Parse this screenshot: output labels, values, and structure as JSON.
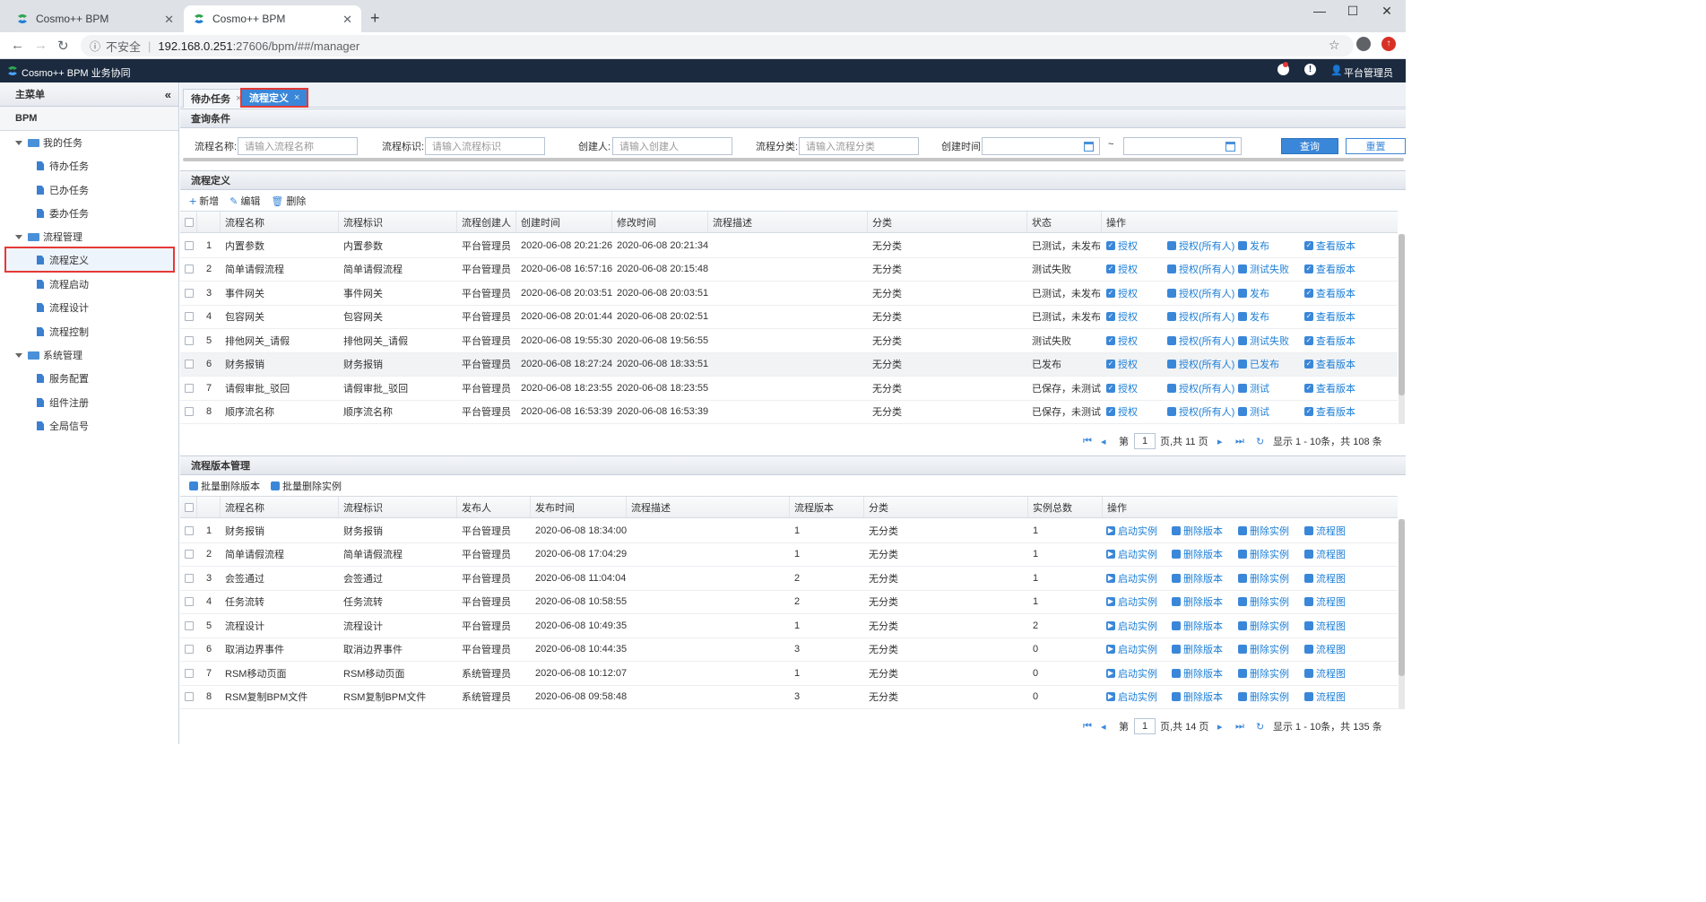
{
  "browser": {
    "tabs": [
      {
        "title": "Cosmo++ BPM",
        "active": false
      },
      {
        "title": "Cosmo++ BPM",
        "active": true
      }
    ],
    "security_label": "不安全",
    "url_host": "192.168.0.251",
    "url_rest": ":27606/bpm/##/manager"
  },
  "app": {
    "title": "Cosmo++ BPM 业务协同",
    "user": "平台管理员"
  },
  "sidebar": {
    "header": "主菜单",
    "section": "BPM",
    "groups": [
      {
        "label": "我的任务",
        "items": [
          "待办任务",
          "已办任务",
          "委办任务"
        ]
      },
      {
        "label": "流程管理",
        "items": [
          "流程定义",
          "流程启动",
          "流程设计",
          "流程控制"
        ]
      },
      {
        "label": "系统管理",
        "items": [
          "服务配置",
          "组件注册",
          "全局信号"
        ]
      }
    ],
    "selected": "流程定义"
  },
  "main_tabs": [
    {
      "label": "待办任务",
      "active": false
    },
    {
      "label": "流程定义",
      "active": true
    }
  ],
  "query": {
    "title": "查询条件",
    "fields": [
      {
        "label": "流程名称:",
        "placeholder": "请输入流程名称"
      },
      {
        "label": "流程标识:",
        "placeholder": "请输入流程标识"
      },
      {
        "label": "创建人:",
        "placeholder": "请输入创建人"
      },
      {
        "label": "流程分类:",
        "placeholder": "请输入流程分类"
      }
    ],
    "time_label": "创建时间:",
    "range_sep": "~",
    "search_btn": "查询",
    "reset_btn": "重置"
  },
  "def_panel": {
    "title": "流程定义",
    "toolbar": [
      "新增",
      "编辑",
      "删除"
    ],
    "columns": [
      "流程名称",
      "流程标识",
      "流程创建人",
      "创建时间",
      "修改时间",
      "流程描述",
      "分类",
      "状态",
      "操作"
    ],
    "rows": [
      {
        "n": "1",
        "name": "内置参数",
        "key": "内置参数",
        "creator": "平台管理员",
        "created": "2020-06-08 20:21:26",
        "modified": "2020-06-08 20:21:34",
        "desc": "",
        "cat": "无分类",
        "status": "已测试，未发布",
        "a1": "授权",
        "a2": "授权(所有人)",
        "a3": "发布",
        "a4": "查看版本"
      },
      {
        "n": "2",
        "name": "简单请假流程",
        "key": "简单请假流程",
        "creator": "平台管理员",
        "created": "2020-06-08 16:57:16",
        "modified": "2020-06-08 20:15:48",
        "desc": "",
        "cat": "无分类",
        "status": "测试失败",
        "a1": "授权",
        "a2": "授权(所有人)",
        "a3": "测试失败",
        "a4": "查看版本"
      },
      {
        "n": "3",
        "name": "事件网关",
        "key": "事件网关",
        "creator": "平台管理员",
        "created": "2020-06-08 20:03:51",
        "modified": "2020-06-08 20:03:51",
        "desc": "",
        "cat": "无分类",
        "status": "已测试，未发布",
        "a1": "授权",
        "a2": "授权(所有人)",
        "a3": "发布",
        "a4": "查看版本"
      },
      {
        "n": "4",
        "name": "包容网关",
        "key": "包容网关",
        "creator": "平台管理员",
        "created": "2020-06-08 20:01:44",
        "modified": "2020-06-08 20:02:51",
        "desc": "",
        "cat": "无分类",
        "status": "已测试，未发布",
        "a1": "授权",
        "a2": "授权(所有人)",
        "a3": "发布",
        "a4": "查看版本"
      },
      {
        "n": "5",
        "name": "排他网关_请假",
        "key": "排他网关_请假",
        "creator": "平台管理员",
        "created": "2020-06-08 19:55:30",
        "modified": "2020-06-08 19:56:55",
        "desc": "",
        "cat": "无分类",
        "status": "测试失败",
        "a1": "授权",
        "a2": "授权(所有人)",
        "a3": "测试失败",
        "a4": "查看版本"
      },
      {
        "n": "6",
        "name": "财务报销",
        "key": "财务报销",
        "creator": "平台管理员",
        "created": "2020-06-08 18:27:24",
        "modified": "2020-06-08 18:33:51",
        "desc": "",
        "cat": "无分类",
        "status": "已发布",
        "a1": "授权",
        "a2": "授权(所有人)",
        "a3": "已发布",
        "a4": "查看版本"
      },
      {
        "n": "7",
        "name": "请假审批_驳回",
        "key": "请假审批_驳回",
        "creator": "平台管理员",
        "created": "2020-06-08 18:23:55",
        "modified": "2020-06-08 18:23:55",
        "desc": "",
        "cat": "无分类",
        "status": "已保存，未测试",
        "a1": "授权",
        "a2": "授权(所有人)",
        "a3": "测试",
        "a4": "查看版本"
      },
      {
        "n": "8",
        "name": "顺序流名称",
        "key": "顺序流名称",
        "creator": "平台管理员",
        "created": "2020-06-08 16:53:39",
        "modified": "2020-06-08 16:53:39",
        "desc": "",
        "cat": "无分类",
        "status": "已保存，未测试",
        "a1": "授权",
        "a2": "授权(所有人)",
        "a3": "测试",
        "a4": "查看版本"
      }
    ],
    "pager": {
      "page_prefix": "第",
      "page": "1",
      "page_suffix": "页,共 11 页",
      "summary": "显示 1 - 10条，共 108 条"
    }
  },
  "ver_panel": {
    "title": "流程版本管理",
    "toolbar": [
      "批量删除版本",
      "批量删除实例"
    ],
    "columns": [
      "流程名称",
      "流程标识",
      "发布人",
      "发布时间",
      "流程描述",
      "流程版本",
      "分类",
      "实例总数",
      "操作"
    ],
    "rows": [
      {
        "n": "1",
        "name": "财务报销",
        "key": "财务报销",
        "pub": "平台管理员",
        "time": "2020-06-08 18:34:00",
        "desc": "",
        "ver": "1",
        "cat": "无分类",
        "count": "1"
      },
      {
        "n": "2",
        "name": "简单请假流程",
        "key": "简单请假流程",
        "pub": "平台管理员",
        "time": "2020-06-08 17:04:29",
        "desc": "",
        "ver": "1",
        "cat": "无分类",
        "count": "1"
      },
      {
        "n": "3",
        "name": "会签通过",
        "key": "会签通过",
        "pub": "平台管理员",
        "time": "2020-06-08 11:04:04",
        "desc": "",
        "ver": "2",
        "cat": "无分类",
        "count": "1"
      },
      {
        "n": "4",
        "name": "任务流转",
        "key": "任务流转",
        "pub": "平台管理员",
        "time": "2020-06-08 10:58:55",
        "desc": "",
        "ver": "2",
        "cat": "无分类",
        "count": "1"
      },
      {
        "n": "5",
        "name": "流程设计",
        "key": "流程设计",
        "pub": "平台管理员",
        "time": "2020-06-08 10:49:35",
        "desc": "",
        "ver": "1",
        "cat": "无分类",
        "count": "2"
      },
      {
        "n": "6",
        "name": "取消边界事件",
        "key": "取消边界事件",
        "pub": "平台管理员",
        "time": "2020-06-08 10:44:35",
        "desc": "",
        "ver": "3",
        "cat": "无分类",
        "count": "0"
      },
      {
        "n": "7",
        "name": "RSM移动页面",
        "key": "RSM移动页面",
        "pub": "系统管理员",
        "time": "2020-06-08 10:12:07",
        "desc": "",
        "ver": "1",
        "cat": "无分类",
        "count": "0"
      },
      {
        "n": "8",
        "name": "RSM复制BPM文件",
        "key": "RSM复制BPM文件",
        "pub": "系统管理员",
        "time": "2020-06-08 09:58:48",
        "desc": "",
        "ver": "3",
        "cat": "无分类",
        "count": "0"
      }
    ],
    "actions": [
      "启动实例",
      "删除版本",
      "删除实例",
      "流程图"
    ],
    "pager": {
      "page_prefix": "第",
      "page": "1",
      "page_suffix": "页,共 14 页",
      "summary": "显示 1 - 10条，共 135 条"
    }
  },
  "colors": {
    "header_bg": "#1b2a3f",
    "accent": "#3a87d9",
    "highlight": "#e53935",
    "link": "#1c7ed6"
  }
}
